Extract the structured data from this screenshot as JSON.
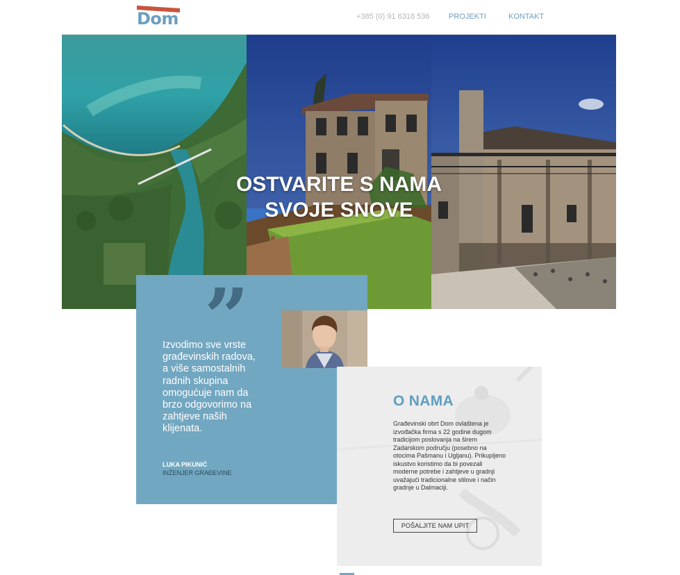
{
  "header": {
    "logo": "Dom",
    "phone": "+385 (0) 91 6318 536",
    "nav": {
      "projekti": "PROJEKTI",
      "kontakt": "KONTAKT"
    }
  },
  "hero": {
    "title_line1": "OSTVARITE S NAMA",
    "title_line2": "SVOJE SNOVE"
  },
  "testimonial": {
    "quote_mark": "”",
    "text": "Izvodimo sve vrste građevinskih radova, a više samostalnih radnih skupina omogućuje nam da brzo odgovorimo na zahtjeve naših klijenata.",
    "author_name": "LUKA PIKUNIĆ",
    "author_role": "INŽENJER GRAĐEVINE"
  },
  "about": {
    "title": "O NAMA",
    "text": "Građevinski obrt Dom ovlaštena je izvođačka firma s 22 godine dugom tradicijom poslovanja na širem Zadarskom području (posebno na otocima Pašmanu i Ugljanu). Prikupljeno iskustvo koristimo da bi povezali moderne potrebe i zahtjeve u gradnji uvažajući tradicionalne stilove i način gradnje u Dalmaciji.",
    "button": "POŠALJITE NAM UPIT"
  },
  "colors": {
    "accent": "#72a7c1",
    "logo_blue": "#6a9fbf",
    "logo_roof": "#c8543e",
    "quote_mark": "#436b83"
  }
}
